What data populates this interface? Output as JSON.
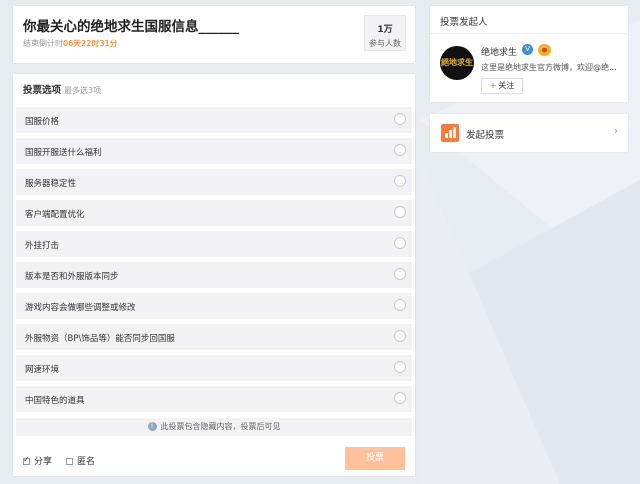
{
  "header": {
    "title": "你最关心的绝地求生国服信息______",
    "countdown_prefix": "结束倒计时",
    "countdown_value": "06天22时31分",
    "participants_count": "1万",
    "participants_label": "参与人数"
  },
  "options": {
    "heading": "投票选项",
    "subheading": "最多选3项",
    "items": [
      {
        "label": "国服价格"
      },
      {
        "label": "国服开服送什么福利"
      },
      {
        "label": "服务器稳定性"
      },
      {
        "label": "客户端配置优化"
      },
      {
        "label": "外挂打击"
      },
      {
        "label": "版本是否和外服版本同步"
      },
      {
        "label": "游戏内容会做哪些调整或修改"
      },
      {
        "label": "外服物资（BP\\饰品等）能否同步回国服"
      },
      {
        "label": "网速环境"
      },
      {
        "label": "中国特色的道具"
      }
    ],
    "notice": "此投票包含隐藏内容，投票后可见",
    "share_label": "分享",
    "share_checked": true,
    "anonymous_label": "匿名",
    "anonymous_checked": false,
    "vote_button": "投票"
  },
  "initiator": {
    "section_title": "投票发起人",
    "name": "绝地求生",
    "avatar_text": "絕地求生",
    "description": "这里是绝地求生官方微博，欢迎@绝...",
    "follow_label": "关注",
    "verified_icon": "verified-v-icon",
    "medal_icon": "medal-icon"
  },
  "launch": {
    "label": "发起投票",
    "icon": "bar-chart-plus-icon"
  },
  "colors": {
    "accent_orange": "#ff6a00",
    "vote_button_bg": "#ffc09a",
    "option_bg": "#f2f2f5",
    "page_bg": "#e7ecf1",
    "verified_blue": "#3e8fd8"
  }
}
